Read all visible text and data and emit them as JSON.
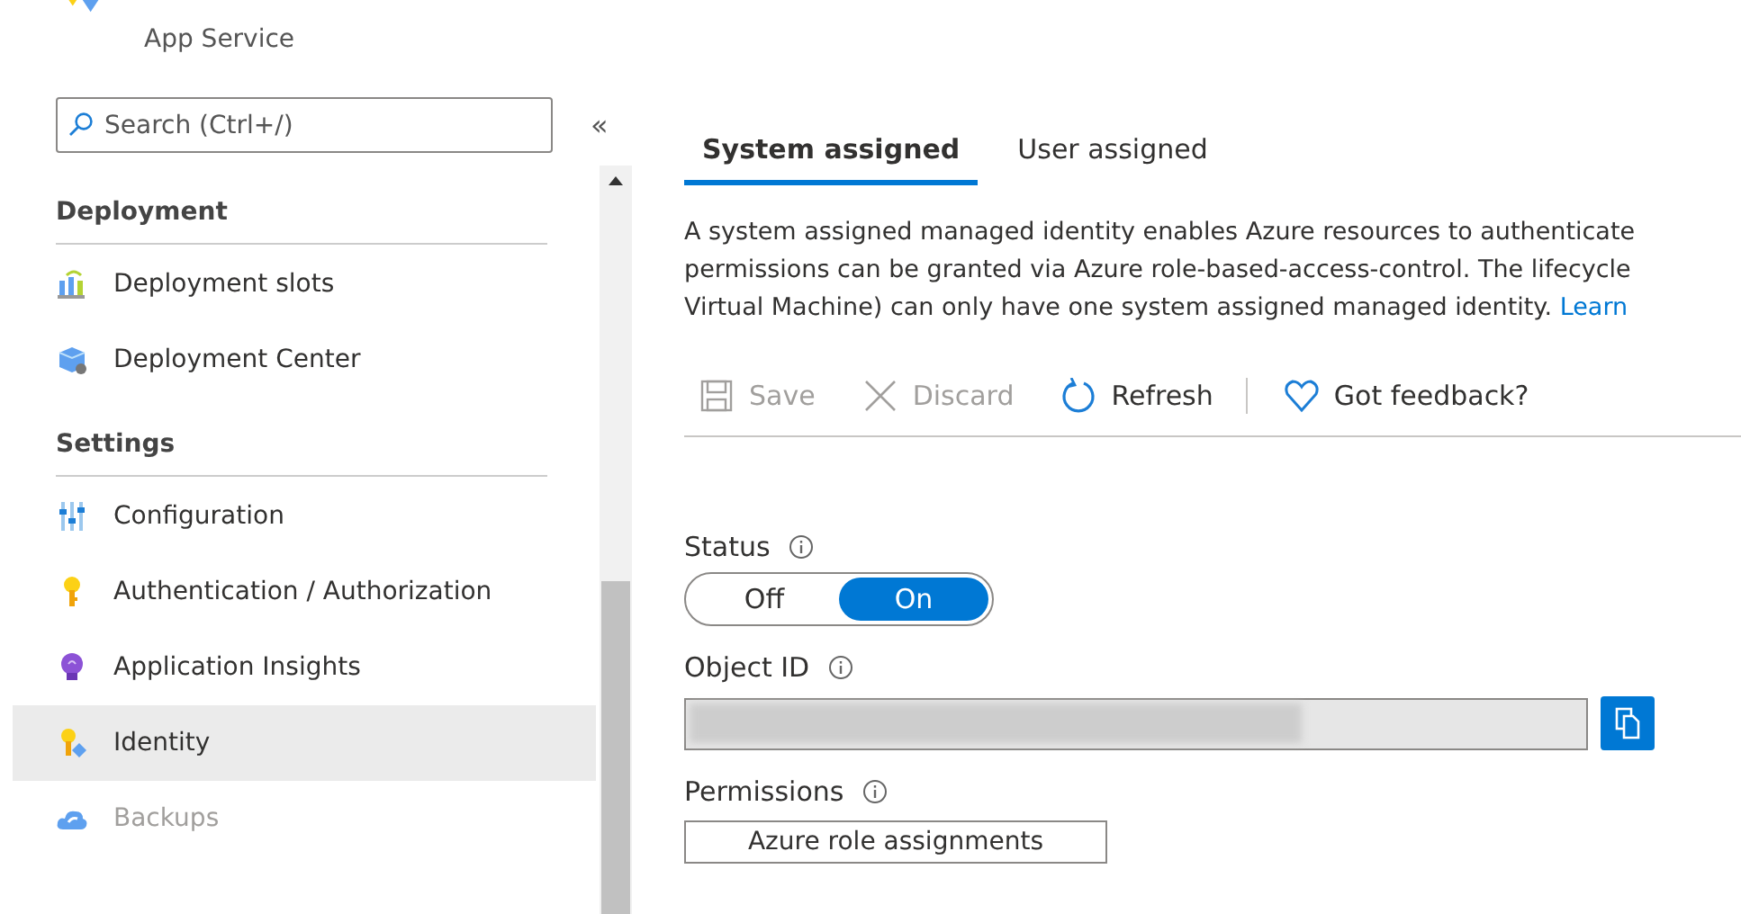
{
  "sidebar": {
    "title": "App Service",
    "search": {
      "placeholder": "Search (Ctrl+/)"
    },
    "collapse": "«",
    "groups": [
      {
        "label": "Deployment",
        "items": [
          {
            "label": "Deployment slots",
            "selected": false,
            "disabled": false
          },
          {
            "label": "Deployment Center",
            "selected": false,
            "disabled": false
          }
        ]
      },
      {
        "label": "Settings",
        "items": [
          {
            "label": "Configuration",
            "selected": false,
            "disabled": false
          },
          {
            "label": "Authentication / Authorization",
            "selected": false,
            "disabled": false
          },
          {
            "label": "Application Insights",
            "selected": false,
            "disabled": false
          },
          {
            "label": "Identity",
            "selected": true,
            "disabled": false
          },
          {
            "label": "Backups",
            "selected": false,
            "disabled": true
          }
        ]
      }
    ]
  },
  "tabs": [
    {
      "label": "System assigned",
      "selected": true
    },
    {
      "label": "User assigned",
      "selected": false
    }
  ],
  "description": {
    "lines": [
      "A system assigned managed identity enables Azure resources to authenticate",
      "permissions can be granted via Azure role-based-access-control. The lifecycle",
      "Virtual Machine) can only have one system assigned managed identity."
    ],
    "link": "Learn"
  },
  "toolbar": [
    {
      "label": "Save",
      "disabled": true
    },
    {
      "label": "Discard",
      "disabled": true
    },
    {
      "label": "Refresh",
      "disabled": false
    },
    {
      "label": "Got feedback?",
      "disabled": false
    }
  ],
  "status": {
    "label": "Status",
    "options": [
      {
        "label": "Off",
        "selected": false
      },
      {
        "label": "On",
        "selected": true
      }
    ]
  },
  "object_id": {
    "label": "Object ID",
    "redacted": true
  },
  "permissions": {
    "label": "Permissions",
    "button": "Azure role assignments"
  }
}
